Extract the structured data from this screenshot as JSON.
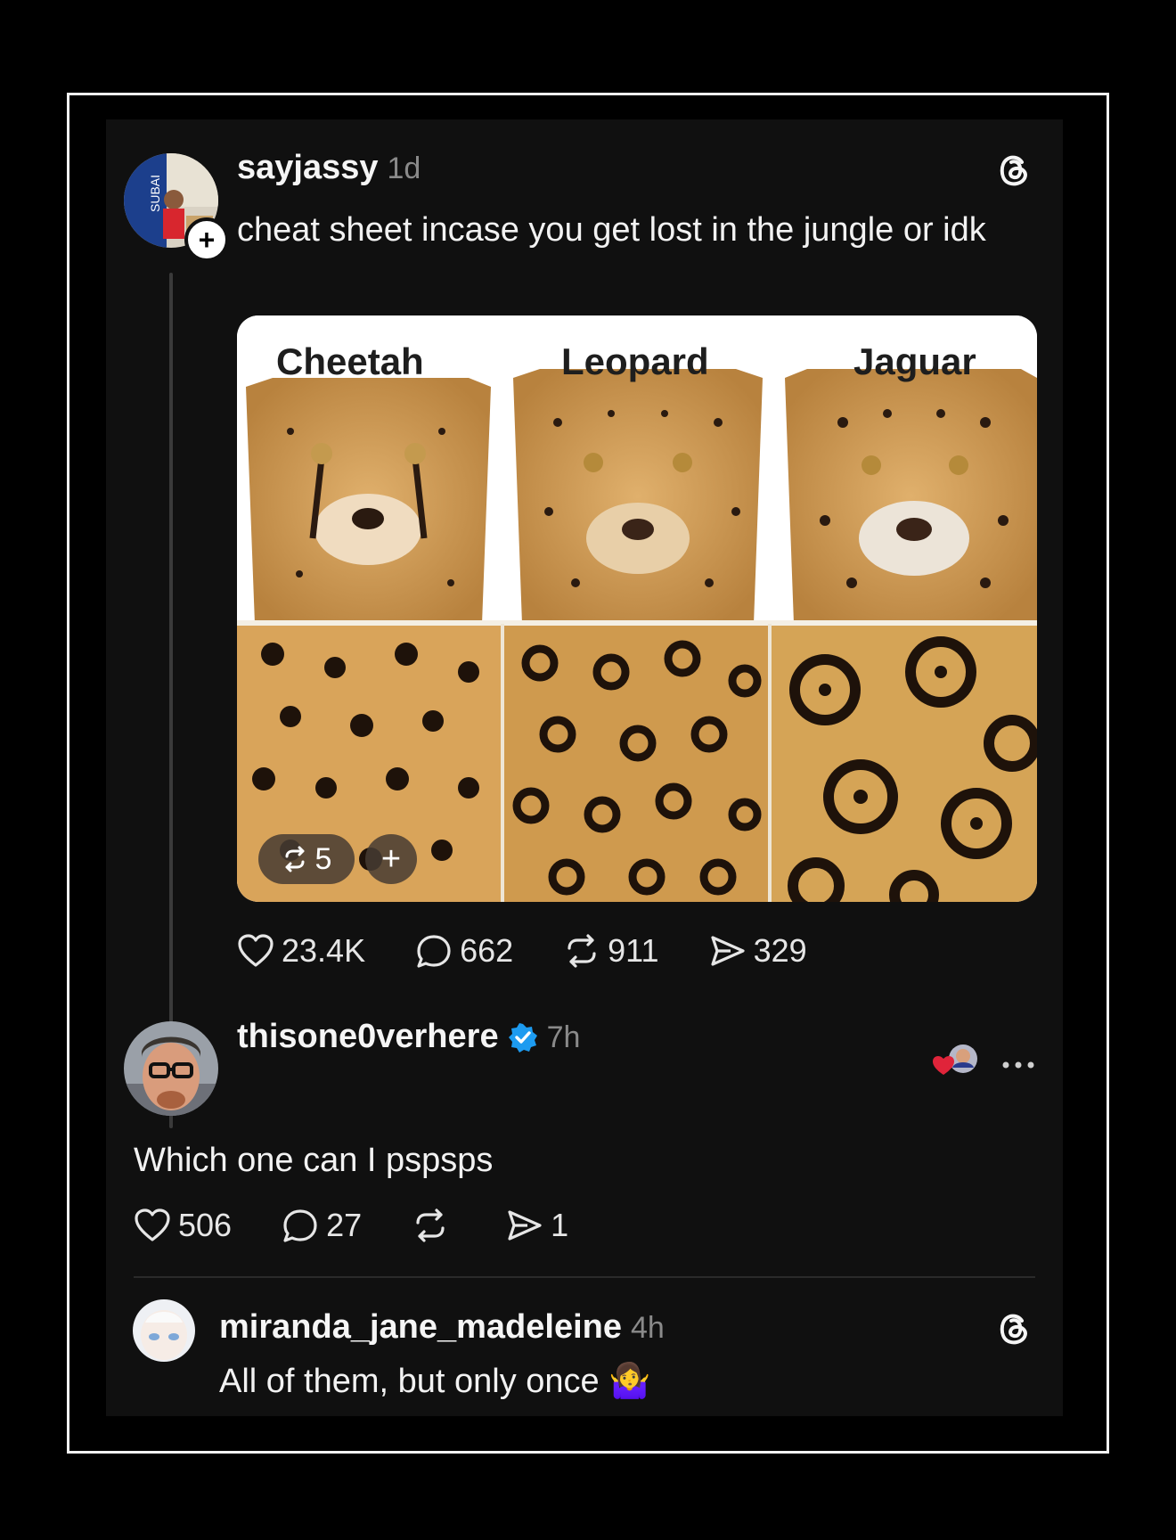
{
  "post": {
    "username": "sayjassy",
    "time": "1d",
    "text": "cheat sheet incase you get lost in the jungle or idk",
    "image_labels": [
      "Cheetah",
      "Leopard",
      "Jaguar"
    ],
    "repost_count_badge": "5",
    "add_badge": "+",
    "stats": {
      "likes": "23.4K",
      "replies": "662",
      "reposts": "911",
      "shares": "329"
    }
  },
  "reply1": {
    "username": "thisone0verhere",
    "time": "7h",
    "text": "Which one can I pspsps",
    "stats": {
      "likes": "506",
      "replies": "27",
      "shares": "1"
    }
  },
  "reply2": {
    "username": "miranda_jane_madeleine",
    "time": "4h",
    "text": "All of them, but only once 🤷‍♀️"
  },
  "icons": {
    "threads_logo": "threads-icon",
    "like": "heart-icon",
    "reply": "comment-icon",
    "repost": "repost-icon",
    "share": "send-icon",
    "more": "more-icon",
    "verified": "verified-badge-icon"
  },
  "colors": {
    "background": "#000000",
    "card": "#101010",
    "verified": "#1d9bf0",
    "like_red": "#e0243a"
  }
}
